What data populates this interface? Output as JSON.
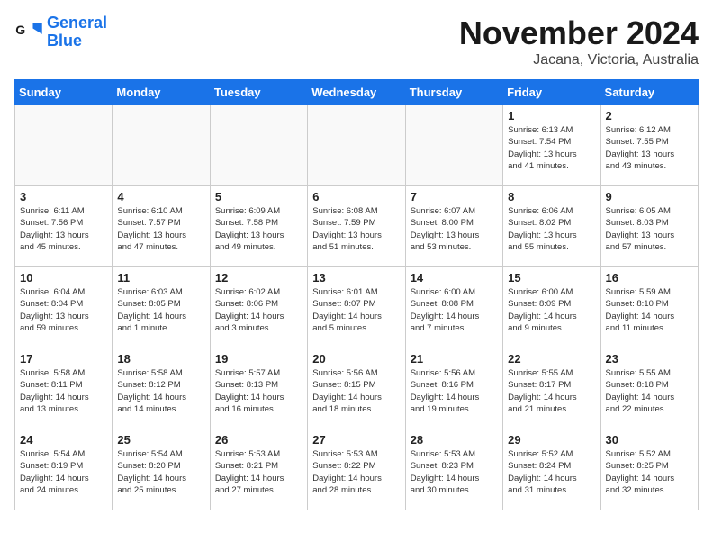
{
  "logo": {
    "line1": "General",
    "line2": "Blue"
  },
  "title": "November 2024",
  "location": "Jacana, Victoria, Australia",
  "weekdays": [
    "Sunday",
    "Monday",
    "Tuesday",
    "Wednesday",
    "Thursday",
    "Friday",
    "Saturday"
  ],
  "weeks": [
    [
      {
        "day": "",
        "content": ""
      },
      {
        "day": "",
        "content": ""
      },
      {
        "day": "",
        "content": ""
      },
      {
        "day": "",
        "content": ""
      },
      {
        "day": "",
        "content": ""
      },
      {
        "day": "1",
        "content": "Sunrise: 6:13 AM\nSunset: 7:54 PM\nDaylight: 13 hours\nand 41 minutes."
      },
      {
        "day": "2",
        "content": "Sunrise: 6:12 AM\nSunset: 7:55 PM\nDaylight: 13 hours\nand 43 minutes."
      }
    ],
    [
      {
        "day": "3",
        "content": "Sunrise: 6:11 AM\nSunset: 7:56 PM\nDaylight: 13 hours\nand 45 minutes."
      },
      {
        "day": "4",
        "content": "Sunrise: 6:10 AM\nSunset: 7:57 PM\nDaylight: 13 hours\nand 47 minutes."
      },
      {
        "day": "5",
        "content": "Sunrise: 6:09 AM\nSunset: 7:58 PM\nDaylight: 13 hours\nand 49 minutes."
      },
      {
        "day": "6",
        "content": "Sunrise: 6:08 AM\nSunset: 7:59 PM\nDaylight: 13 hours\nand 51 minutes."
      },
      {
        "day": "7",
        "content": "Sunrise: 6:07 AM\nSunset: 8:00 PM\nDaylight: 13 hours\nand 53 minutes."
      },
      {
        "day": "8",
        "content": "Sunrise: 6:06 AM\nSunset: 8:02 PM\nDaylight: 13 hours\nand 55 minutes."
      },
      {
        "day": "9",
        "content": "Sunrise: 6:05 AM\nSunset: 8:03 PM\nDaylight: 13 hours\nand 57 minutes."
      }
    ],
    [
      {
        "day": "10",
        "content": "Sunrise: 6:04 AM\nSunset: 8:04 PM\nDaylight: 13 hours\nand 59 minutes."
      },
      {
        "day": "11",
        "content": "Sunrise: 6:03 AM\nSunset: 8:05 PM\nDaylight: 14 hours\nand 1 minute."
      },
      {
        "day": "12",
        "content": "Sunrise: 6:02 AM\nSunset: 8:06 PM\nDaylight: 14 hours\nand 3 minutes."
      },
      {
        "day": "13",
        "content": "Sunrise: 6:01 AM\nSunset: 8:07 PM\nDaylight: 14 hours\nand 5 minutes."
      },
      {
        "day": "14",
        "content": "Sunrise: 6:00 AM\nSunset: 8:08 PM\nDaylight: 14 hours\nand 7 minutes."
      },
      {
        "day": "15",
        "content": "Sunrise: 6:00 AM\nSunset: 8:09 PM\nDaylight: 14 hours\nand 9 minutes."
      },
      {
        "day": "16",
        "content": "Sunrise: 5:59 AM\nSunset: 8:10 PM\nDaylight: 14 hours\nand 11 minutes."
      }
    ],
    [
      {
        "day": "17",
        "content": "Sunrise: 5:58 AM\nSunset: 8:11 PM\nDaylight: 14 hours\nand 13 minutes."
      },
      {
        "day": "18",
        "content": "Sunrise: 5:58 AM\nSunset: 8:12 PM\nDaylight: 14 hours\nand 14 minutes."
      },
      {
        "day": "19",
        "content": "Sunrise: 5:57 AM\nSunset: 8:13 PM\nDaylight: 14 hours\nand 16 minutes."
      },
      {
        "day": "20",
        "content": "Sunrise: 5:56 AM\nSunset: 8:15 PM\nDaylight: 14 hours\nand 18 minutes."
      },
      {
        "day": "21",
        "content": "Sunrise: 5:56 AM\nSunset: 8:16 PM\nDaylight: 14 hours\nand 19 minutes."
      },
      {
        "day": "22",
        "content": "Sunrise: 5:55 AM\nSunset: 8:17 PM\nDaylight: 14 hours\nand 21 minutes."
      },
      {
        "day": "23",
        "content": "Sunrise: 5:55 AM\nSunset: 8:18 PM\nDaylight: 14 hours\nand 22 minutes."
      }
    ],
    [
      {
        "day": "24",
        "content": "Sunrise: 5:54 AM\nSunset: 8:19 PM\nDaylight: 14 hours\nand 24 minutes."
      },
      {
        "day": "25",
        "content": "Sunrise: 5:54 AM\nSunset: 8:20 PM\nDaylight: 14 hours\nand 25 minutes."
      },
      {
        "day": "26",
        "content": "Sunrise: 5:53 AM\nSunset: 8:21 PM\nDaylight: 14 hours\nand 27 minutes."
      },
      {
        "day": "27",
        "content": "Sunrise: 5:53 AM\nSunset: 8:22 PM\nDaylight: 14 hours\nand 28 minutes."
      },
      {
        "day": "28",
        "content": "Sunrise: 5:53 AM\nSunset: 8:23 PM\nDaylight: 14 hours\nand 30 minutes."
      },
      {
        "day": "29",
        "content": "Sunrise: 5:52 AM\nSunset: 8:24 PM\nDaylight: 14 hours\nand 31 minutes."
      },
      {
        "day": "30",
        "content": "Sunrise: 5:52 AM\nSunset: 8:25 PM\nDaylight: 14 hours\nand 32 minutes."
      }
    ]
  ]
}
